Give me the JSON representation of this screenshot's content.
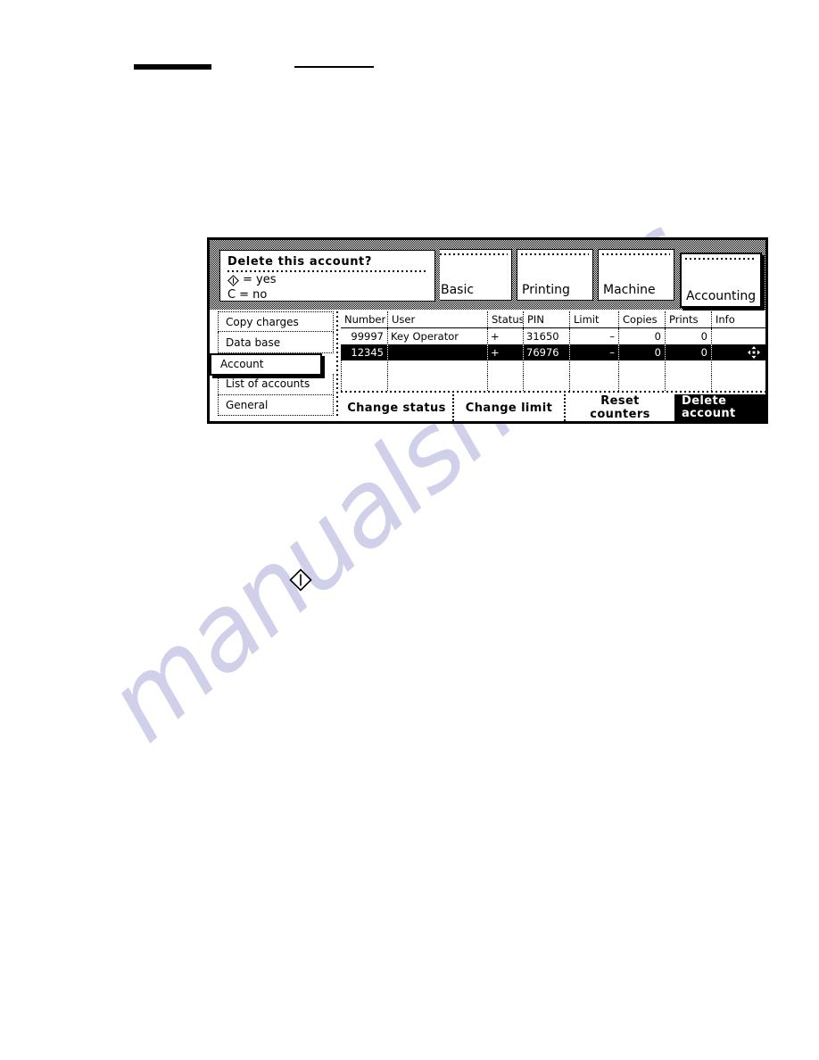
{
  "page": {
    "background_color": "#ffffff",
    "watermark_text": "manualshive.c"
  },
  "header": {
    "rule_thick": "",
    "rule_thin": ""
  },
  "body_glyph": {
    "start_key_icon": "start-key-diamond"
  },
  "panel": {
    "dialog": {
      "title": "Delete this account?",
      "options": [
        {
          "key_icon": "start-key-diamond",
          "key_label": "",
          "text": "= yes"
        },
        {
          "key_icon": "",
          "key_label": "C",
          "text": "= no"
        }
      ]
    },
    "tabs": [
      {
        "id": "basic",
        "label": "Basic",
        "selected": false
      },
      {
        "id": "printing",
        "label": "Printing",
        "selected": false
      },
      {
        "id": "machine",
        "label": "Machine",
        "selected": false
      },
      {
        "id": "accounting",
        "label": "Accounting",
        "selected": true
      }
    ],
    "sidebar": {
      "items": [
        {
          "label": "Copy charges",
          "selected": false
        },
        {
          "label": "Data base",
          "selected": false
        },
        {
          "label": "Account",
          "selected": true
        },
        {
          "label": "List of accounts",
          "selected": false
        },
        {
          "label": "General",
          "selected": false
        }
      ]
    },
    "table": {
      "columns": [
        "Number",
        "User",
        "Status",
        "PIN",
        "Limit",
        "Copies",
        "Prints",
        "Info"
      ],
      "rows": [
        {
          "number": "99997",
          "user": "Key Operator",
          "status": "+",
          "pin": "31650",
          "limit": "–",
          "copies": "0",
          "prints": "0",
          "info": "",
          "selected": false
        },
        {
          "number": "12345",
          "user": "",
          "status": "+",
          "pin": "76976",
          "limit": "–",
          "copies": "0",
          "prints": "0",
          "info": "",
          "info_icon": "move-four-way-arrows-icon",
          "selected": true
        }
      ]
    },
    "actions": [
      {
        "id": "change-status",
        "label": "Change status",
        "selected": false
      },
      {
        "id": "change-limit",
        "label": "Change limit",
        "selected": false
      },
      {
        "id": "reset-counters",
        "label": "Reset counters",
        "selected": false
      },
      {
        "id": "delete-account",
        "label_line1": "Delete",
        "label_line2": "account",
        "selected": true
      }
    ]
  }
}
